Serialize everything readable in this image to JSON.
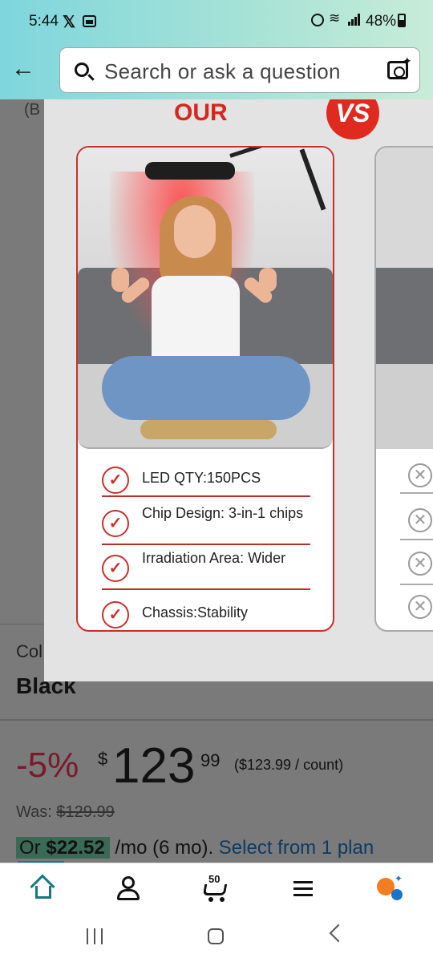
{
  "status_bar": {
    "time": "5:44",
    "battery": "48%"
  },
  "search": {
    "placeholder": "Search or ask a question"
  },
  "page": {
    "partial_text": "(B",
    "color_label": "Col",
    "color_value": "Black",
    "discount": "-5%",
    "currency": "$",
    "price_whole": "123",
    "price_cents": "99",
    "price_per": "($123.99 / count)",
    "was_label": "Was:",
    "was_price": "$129.99",
    "monthly_prefix": "Or",
    "monthly_amount": "$22.52",
    "monthly_suffix": "/mo (6 mo).",
    "monthly_link": "Select from 1 plan"
  },
  "overlay": {
    "title": "OUR",
    "badge": "VS",
    "features": [
      {
        "label": "LED QTY:150PCS"
      },
      {
        "label": "Chip Design: 3-in-1 chips"
      },
      {
        "label": "Irradiation Area: Wider"
      },
      {
        "label": "Chassis:Stability"
      }
    ]
  },
  "bottom_nav": {
    "cart_count": "50"
  },
  "colors": {
    "accent_teal": "#127a7e",
    "brand_red": "#d8261f",
    "rufus_orange": "#f47d1f",
    "rufus_blue": "#1a73c7"
  }
}
